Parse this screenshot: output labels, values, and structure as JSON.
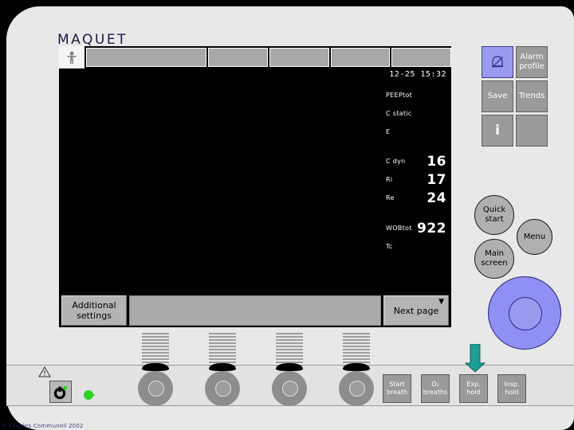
{
  "device": {
    "brand": "MAQUET",
    "copyright": "© Charles Communell 2002"
  },
  "screen": {
    "timestamp": "12-25 15:32",
    "toolbar": {
      "patient_icon": "patient-figure-icon",
      "tabs": [
        "",
        "",
        "",
        "",
        ""
      ]
    },
    "measurements": [
      {
        "label": "PEEPtot",
        "value": ""
      },
      {
        "label": "C static",
        "value": ""
      },
      {
        "label": "E",
        "value": ""
      },
      {
        "label": "C dyn",
        "value": "16"
      },
      {
        "label": "Ri",
        "value": "17"
      },
      {
        "label": "Re",
        "value": "24"
      },
      {
        "label": "WOBtot",
        "value": "922"
      },
      {
        "label": "Tc",
        "value": ""
      }
    ],
    "bottom_bar": {
      "additional_settings": "Additional settings",
      "next_page": "Next page",
      "next_page_caret": "▼"
    }
  },
  "keypad": {
    "alarm_silence_icon": "bell-slash-icon",
    "alarm_profile": "Alarm profile",
    "save": "Save",
    "trends": "Trends",
    "info": "i",
    "blank": ""
  },
  "round_buttons": {
    "quick_start": "Quick start",
    "menu": "Menu",
    "main_screen": "Main screen"
  },
  "bottom_keys": [
    {
      "label": "Start breath"
    },
    {
      "label": "O₂ breaths"
    },
    {
      "label": "Exp. hold"
    },
    {
      "label": "Insp. hold"
    }
  ],
  "indicators": {
    "warning_icon": "warning-triangle-icon",
    "power_icon": "power-button-icon",
    "status_led": "green-status-led"
  },
  "colors": {
    "shell": "#e8e8e8",
    "screen": "#000000",
    "accent_purple": "#9a9aee",
    "dial": "#8f8ff4",
    "teal": "#1f9e96",
    "led_green": "#2fd321",
    "brand_navy": "#1b1b4a"
  }
}
